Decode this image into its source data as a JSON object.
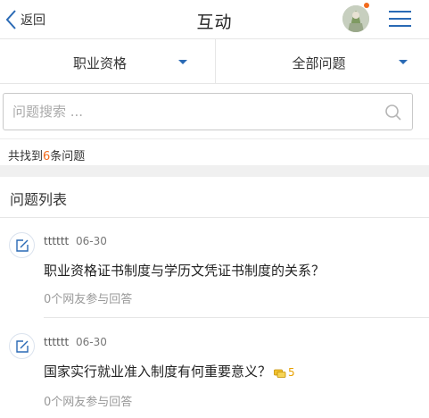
{
  "header": {
    "back_label": "返回",
    "title": "互动"
  },
  "filters": [
    {
      "label": "职业资格"
    },
    {
      "label": "全部问题"
    }
  ],
  "search": {
    "placeholder": "问题搜索 ..."
  },
  "result": {
    "prefix": "共找到",
    "count": "6",
    "suffix": "条问题"
  },
  "list": {
    "title": "问题列表",
    "items": [
      {
        "author": "tttttt",
        "date": "06-30",
        "question": "职业资格证书制度与学历文凭证书制度的关系？",
        "answers": "0个网友参与回答"
      },
      {
        "author": "tttttt",
        "date": "06-30",
        "question": "国家实行就业准入制度有何重要意义？",
        "reward": "5",
        "answers": "0个网友参与回答"
      }
    ]
  },
  "colors": {
    "accent": "#2a6ab5",
    "count_highlight": "#f26b1d",
    "reward": "#e8a100"
  }
}
